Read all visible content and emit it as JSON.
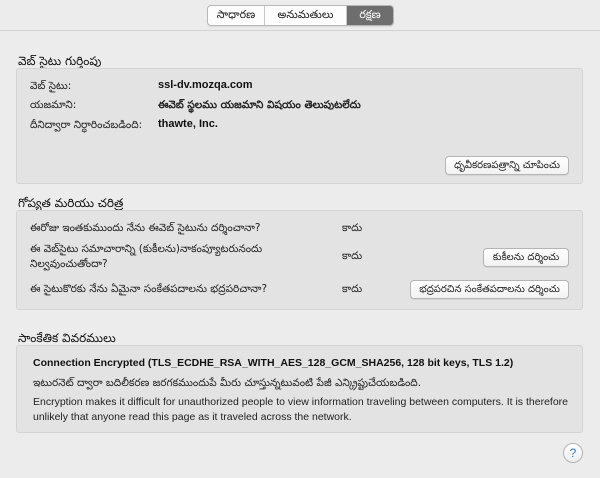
{
  "tabs": [
    {
      "label": "సాధారణ",
      "active": false
    },
    {
      "label": "అనుమతులు",
      "active": false
    },
    {
      "label": "రక్షణ",
      "active": true
    }
  ],
  "website_identity": {
    "title": "వెబ్ సైటు గుర్తింపు",
    "site_label": "వెబ్ సైటు:",
    "site_value": "ssl-dv.mozqa.com",
    "owner_label": "యజమాని:",
    "owner_value": "ఈవెబ్ స్థలము యజమాని విషయం తెలుపుటలేదు",
    "verifier_label": "దీనిద్వారా నిర్ధారించబడింది:",
    "verifier_value": "thawte, Inc.",
    "view_cert_button": "ధృవీకరణపత్రాన్ని చూపించు"
  },
  "privacy_history": {
    "title": "గోప్యత మరియు చరిత్ర",
    "q1_label": "ఈరోజు ఇంతకుముందు నేను ఈవెబ్ సైటును దర్శించానా?",
    "q1_value": "కాదు",
    "q2_label": "ఈ వెబ్‌సైటు సమాచారాన్ని (కుకీలను)నాకంప్యూటరునందు నిల్వవుంచుతోందా?",
    "q2_value": "కాదు",
    "q2_button": "కుకీలను దర్శించు",
    "q3_label": "ఈ సైటుకొరకు నేను ఏమైనా సంకేతపదాలను భద్రపరిచానా?",
    "q3_value": "కాదు",
    "q3_button": "భద్రపరచిన సంకేతపదాలను దర్శించు"
  },
  "technical_details": {
    "title": "సాంకేతిక వివరములు",
    "connection": "Connection Encrypted (TLS_ECDHE_RSA_WITH_AES_128_GCM_SHA256, 128 bit keys, TLS 1.2)",
    "line1": "ఇటురనెట్ ద్వారా బదిలీకరణ జరగకముందుపే మీరు చూస్తున్నటువంటి పేజీ ఎన్క్రిప్టుచేయబడింది.",
    "line2": "Encryption makes it difficult for unauthorized people to view information traveling between computers. It is therefore unlikely that anyone read this page as it traveled across the network."
  },
  "help_label": "?"
}
